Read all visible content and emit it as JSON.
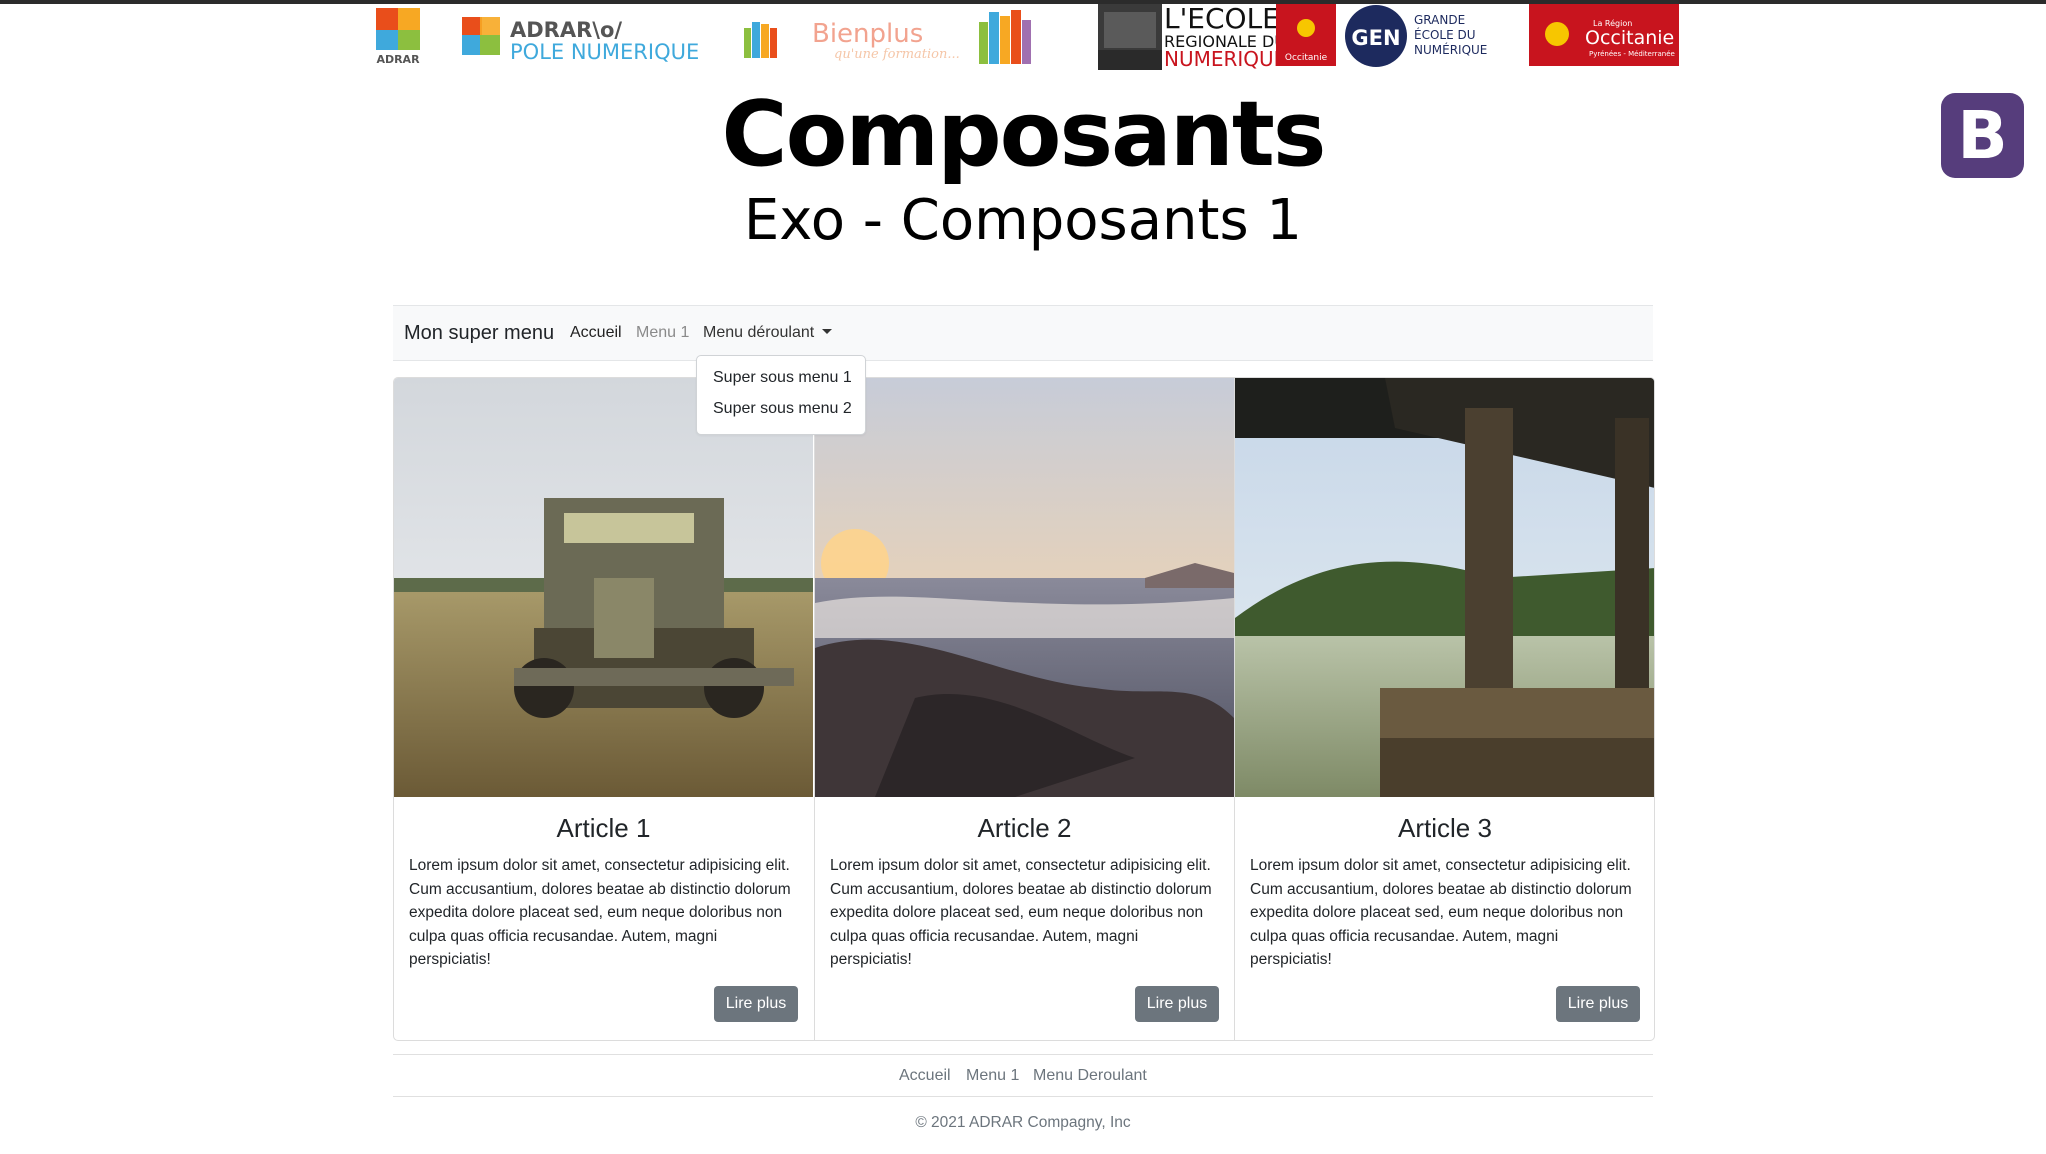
{
  "colors": {
    "navbar_bg": "#f8f9fa",
    "button_bg": "#6c757d",
    "bootstrap_purple": "#563d7c",
    "occitanie_red": "#c8141e",
    "gen_navy": "#1d2a5e"
  },
  "banner": {
    "adrar_small": "ADRAR",
    "adrar_pole_line1": "ADRAR\\o/",
    "adrar_pole_line2": "POLE NUMERIQUE",
    "bienplus_title": "Bienplus",
    "bienplus_tagline": "qu'une formation...",
    "ecole_line1": "L'ECOLE",
    "ecole_line2": "REGIONALE DU",
    "ecole_line3": "NUMERIQUE",
    "occitanie_small": "Occitanie",
    "gen_mark": "GEN",
    "gen_line1": "GRANDE",
    "gen_line2": "ÉCOLE DU",
    "gen_line3": "NUMÉRIQUE",
    "region_pre": "La Région",
    "region_name": "Occitanie",
    "region_sub": "Pyrénées - Méditerranée"
  },
  "bootstrap_logo": "B",
  "header": {
    "title": "Composants",
    "subtitle": "Exo - Composants 1"
  },
  "navbar": {
    "brand": "Mon super menu",
    "links": [
      "Accueil",
      "Menu 1",
      "Menu déroulant"
    ],
    "dropdown_items": [
      "Super sous menu 1",
      "Super sous menu 2"
    ]
  },
  "cards": [
    {
      "image": "rusty-old-truck-in-field",
      "title": "Article 1",
      "text": "Lorem ipsum dolor sit amet, consectetur adipisicing elit. Cum accusantium, dolores beatae ab distinctio dolorum expedita dolore placeat sed, eum neque doloribus non culpa quas officia recusandae. Autem, magni perspiciatis!",
      "button": "Lire plus"
    },
    {
      "image": "sunset-waves-on-rocks",
      "title": "Article 2",
      "text": "Lorem ipsum dolor sit amet, consectetur adipisicing elit. Cum accusantium, dolores beatae ab distinctio dolorum expedita dolore placeat sed, eum neque doloribus non culpa quas officia recusandae. Autem, magni perspiciatis!",
      "button": "Lire plus"
    },
    {
      "image": "wooden-dock-on-misty-lake",
      "title": "Article 3",
      "text": "Lorem ipsum dolor sit amet, consectetur adipisicing elit. Cum accusantium, dolores beatae ab distinctio dolorum expedita dolore placeat sed, eum neque doloribus non culpa quas officia recusandae. Autem, magni perspiciatis!",
      "button": "Lire plus"
    }
  ],
  "footer": {
    "links": [
      "Accueil",
      "Menu 1",
      "Menu Deroulant"
    ],
    "copyright": "© 2021 ADRAR Compagny, Inc"
  }
}
